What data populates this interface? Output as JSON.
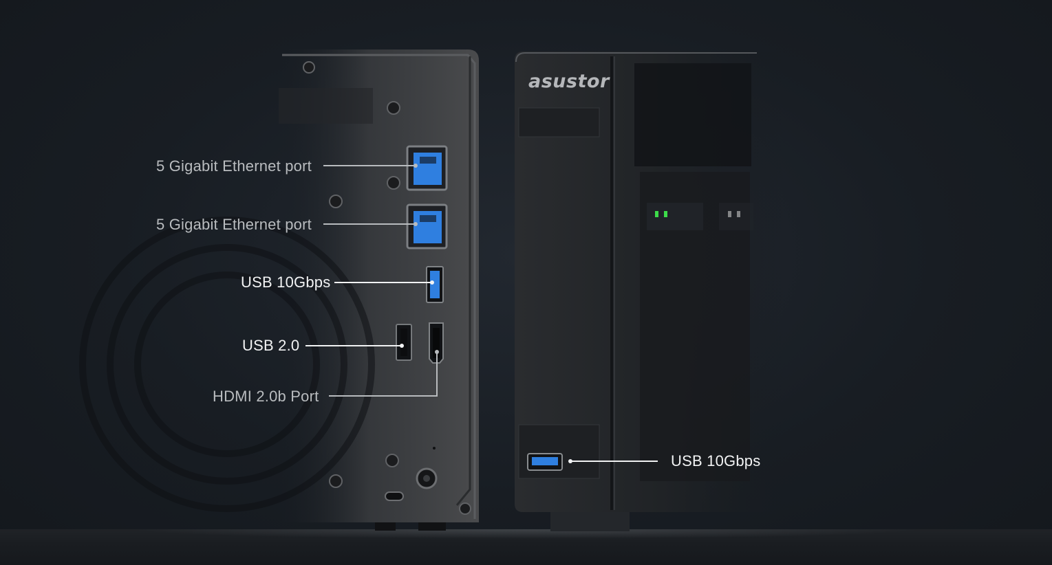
{
  "brand": {
    "logo_text": "asustor"
  },
  "callouts": {
    "ethernet_port_1": "5 Gigabit Ethernet port",
    "ethernet_port_2": "5 Gigabit Ethernet port",
    "usb_rear": "USB 10Gbps",
    "usb_2": "USB 2.0",
    "hdmi": "HDMI 2.0b Port",
    "usb_front": "USB 10Gbps"
  },
  "colors": {
    "background": "#181d23",
    "led_blue": "#2f9bff",
    "led_green": "#3ddc4a",
    "port_blue": "#2f7fe0",
    "chassis": "#2b2d30"
  },
  "icons": {
    "ethernet_port": "ethernet-port-icon",
    "usb_port": "usb-port-icon",
    "hdmi_port": "hdmi-port-icon",
    "power_jack": "power-jack-icon",
    "kensington_lock": "kensington-lock-icon"
  }
}
